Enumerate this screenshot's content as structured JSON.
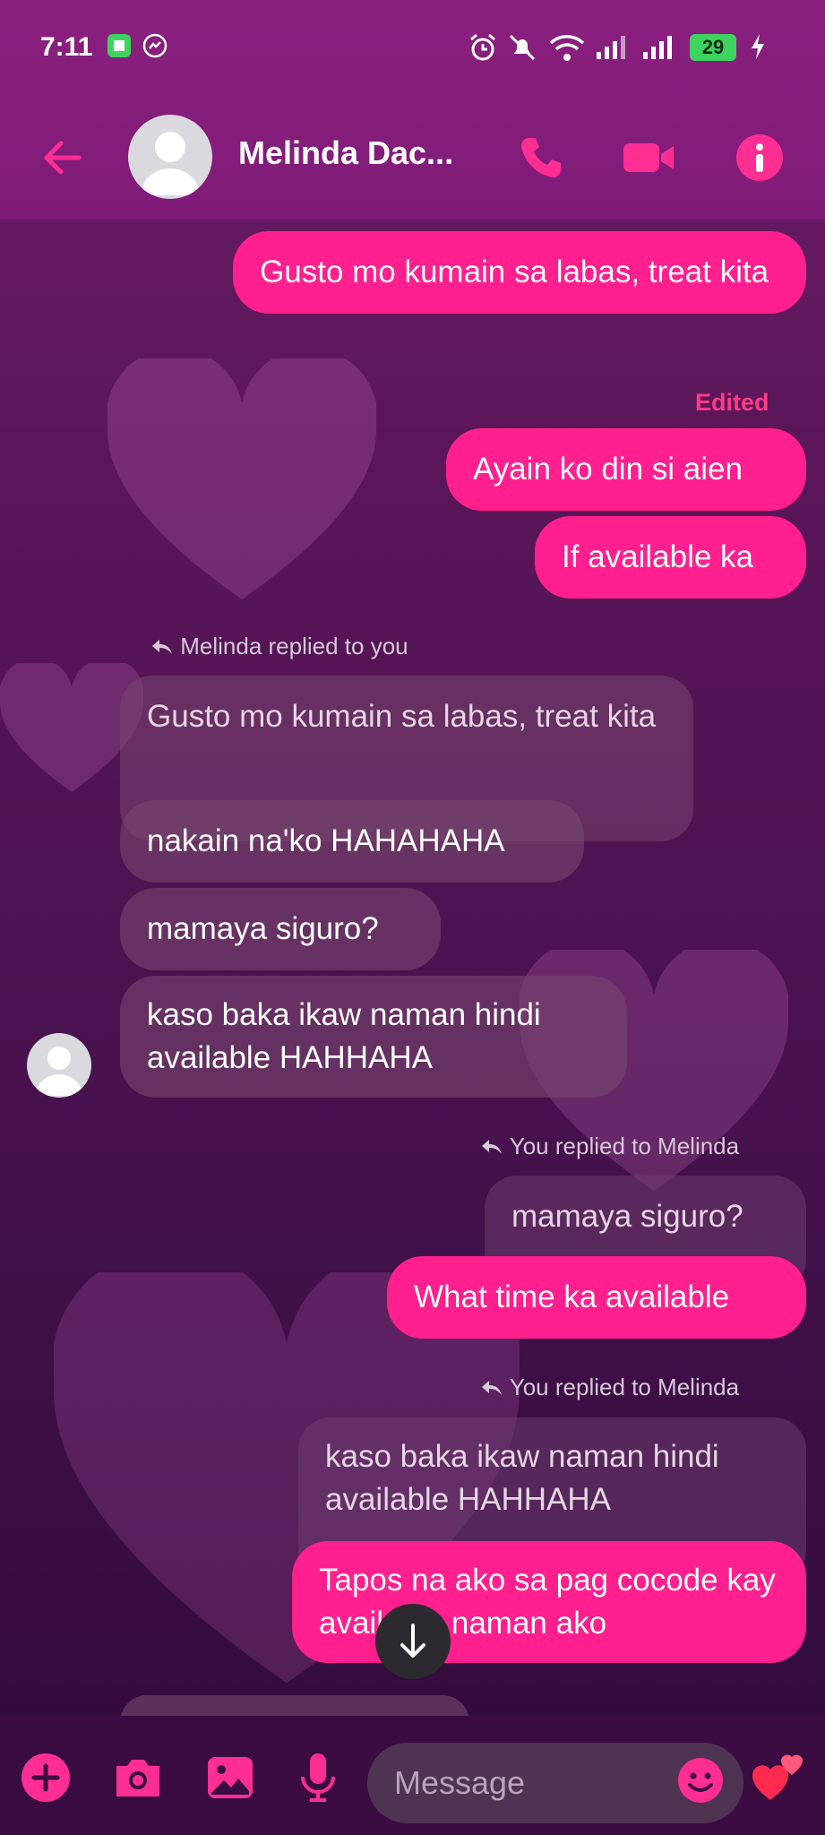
{
  "status_bar": {
    "time": "7:11",
    "battery": "29"
  },
  "header": {
    "contact_name": "Melinda Dac...",
    "icons": [
      "back-arrow-icon",
      "phone-icon",
      "video-camera-icon",
      "info-icon"
    ],
    "accent": "#ff2e93"
  },
  "messages": [
    {
      "id": "m1",
      "from": "you",
      "text": "Gusto mo kumain sa labas, treat kita"
    },
    {
      "id": "m2",
      "from": "you",
      "edited_label": "Edited",
      "text": "Ayain ko din si aien"
    },
    {
      "id": "m3",
      "from": "you",
      "text": "If available ka"
    },
    {
      "id": "r1",
      "reply_label": "Melinda replied to you",
      "quoted": "Gusto mo kumain sa labas, treat kita"
    },
    {
      "id": "m4",
      "from": "melinda",
      "text": "nakain na'ko HAHAHAHA"
    },
    {
      "id": "m5",
      "from": "melinda",
      "text": "mamaya siguro?"
    },
    {
      "id": "m6",
      "from": "melinda",
      "text": "kaso baka ikaw naman hindi available HAHHAHA"
    },
    {
      "id": "r2",
      "reply_label": "You replied to Melinda",
      "quoted": "mamaya siguro?"
    },
    {
      "id": "m7",
      "from": "you",
      "text": "What time ka available"
    },
    {
      "id": "r3",
      "reply_label": "You replied to Melinda",
      "quoted": "kaso baka ikaw naman hindi available HAHHAHA"
    },
    {
      "id": "m8",
      "from": "you",
      "text": "Tapos na ako sa pag cocode kay available naman ako"
    }
  ],
  "composer": {
    "placeholder": "Message",
    "icons": [
      "plus-icon",
      "camera-icon",
      "image-icon",
      "microphone-icon",
      "emoji-icon",
      "heart-icon"
    ]
  },
  "colors": {
    "outgoing_bubble": "#ff1f8e",
    "header_bg": "#8a1f7e",
    "composer_bg": "#3a0c42"
  }
}
